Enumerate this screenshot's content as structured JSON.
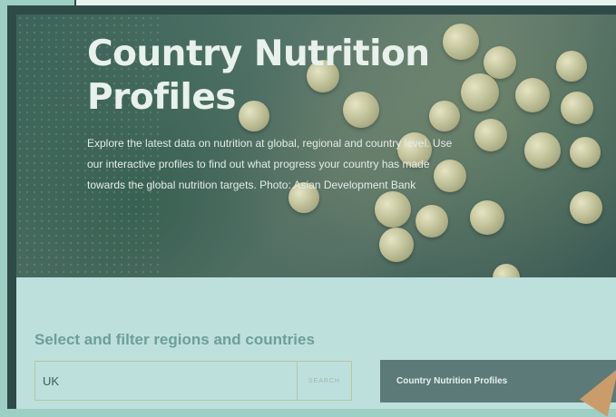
{
  "hero": {
    "title_line1": "Country Nutrition",
    "title_line2": "Profiles",
    "description": "Explore the latest data on nutrition at global, regional and country level. Use our interactive profiles to find out what progress your country has made towards the global nutrition targets. Photo: Asian Development Bank"
  },
  "filter": {
    "heading": "Select and filter regions and countries",
    "search_value": "UK",
    "search_button": "SEARCH",
    "profiles_button": "Country Nutrition Profiles"
  },
  "colors": {
    "background": "#9ecfc4",
    "card": "#2f4b47",
    "filter_bg": "#bde0dd",
    "button": "#5b7a78"
  },
  "icons": {
    "cursor": "hand-pointer-icon"
  }
}
